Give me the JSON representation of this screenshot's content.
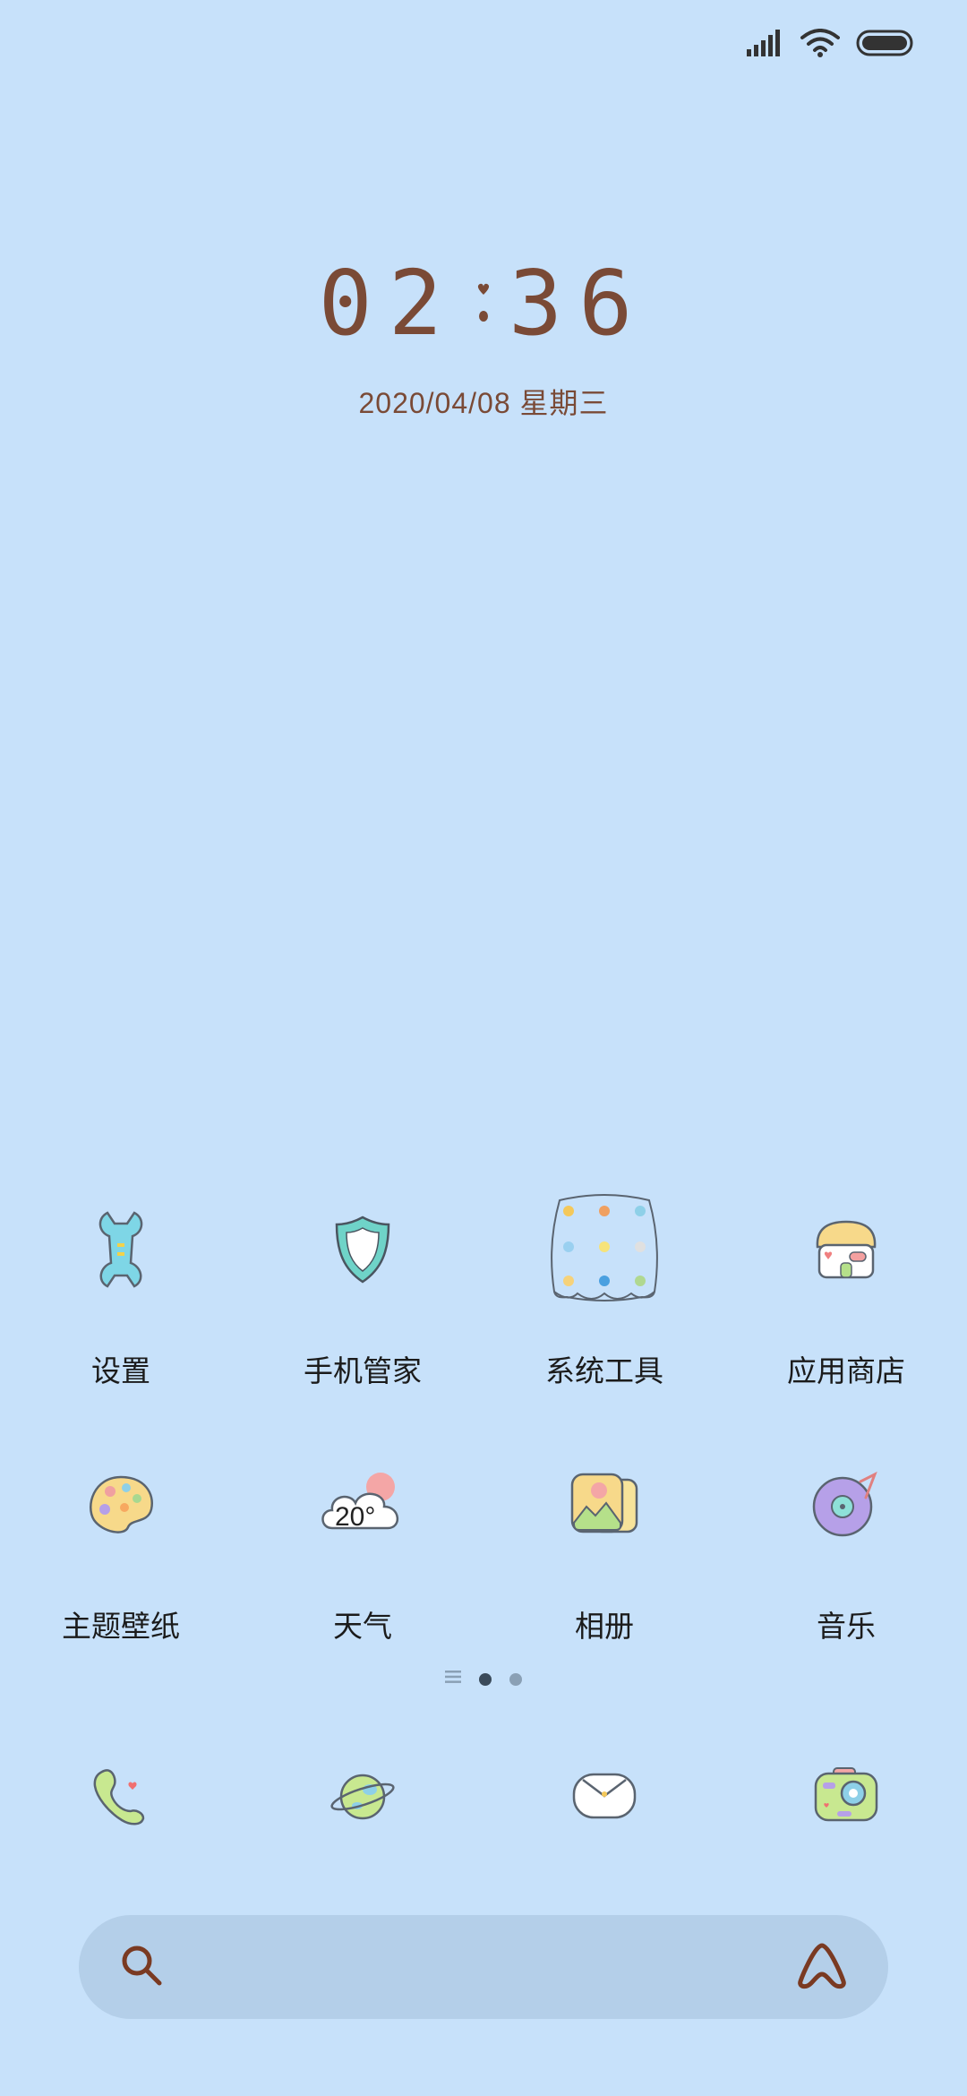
{
  "status_bar": {
    "signal_icon": "cellular-signal-icon",
    "wifi_icon": "wifi-icon",
    "battery_icon": "battery-icon"
  },
  "clock": {
    "hours": "02",
    "minutes": "36",
    "date": "2020/04/08 星期三"
  },
  "apps": [
    {
      "label": "设置",
      "icon": "settings-wrench-icon"
    },
    {
      "label": "手机管家",
      "icon": "security-shield-icon"
    },
    {
      "label": "系统工具",
      "icon": "folder-icon"
    },
    {
      "label": "应用商店",
      "icon": "app-store-icon"
    },
    {
      "label": "主题壁纸",
      "icon": "palette-icon"
    },
    {
      "label": "天气",
      "icon": "weather-cloud-icon",
      "badge": "20°"
    },
    {
      "label": "相册",
      "icon": "gallery-icon"
    },
    {
      "label": "音乐",
      "icon": "music-record-icon"
    }
  ],
  "page_indicator": {
    "pages": 2,
    "current": 1
  },
  "dock": [
    {
      "icon": "phone-icon"
    },
    {
      "icon": "browser-planet-icon"
    },
    {
      "icon": "messages-icon"
    },
    {
      "icon": "camera-icon"
    }
  ],
  "search": {
    "placeholder": "",
    "search_icon": "search-icon",
    "assistant_icon": "assistant-icon"
  },
  "colors": {
    "background": "#c7e1fa",
    "clock_text": "#7a4a36",
    "search_bar": "#b4cfe9"
  }
}
